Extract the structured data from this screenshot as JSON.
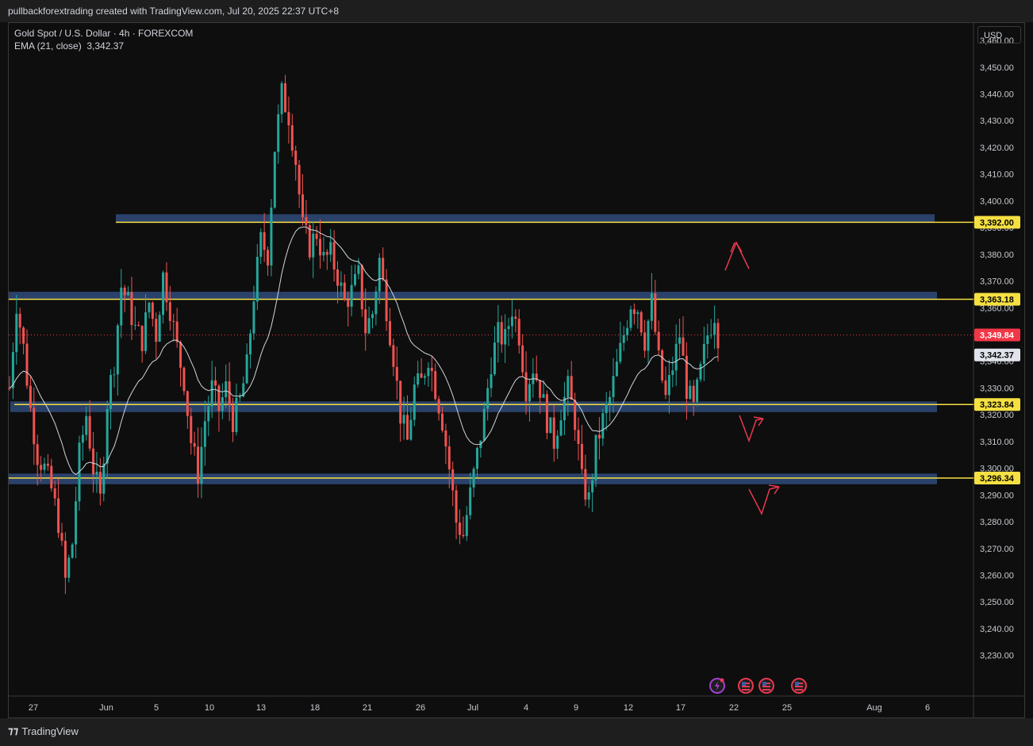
{
  "header": {
    "credit": "pullbackforextrading created with TradingView.com, Jul 20, 2025 22:37 UTC+8"
  },
  "legend": {
    "symbol": "Gold Spot / U.S. Dollar · 4h · FOREXCOM",
    "indicator": "EMA (21, close)",
    "indicator_value": "3,342.37"
  },
  "currency": "USD",
  "footer": {
    "brand": "TradingView"
  },
  "colors": {
    "up": "#26a69a",
    "down": "#ef5350",
    "zone": "#2f4a7a",
    "level_line": "#f5e042",
    "ema": "#d1d4dc",
    "arrow": "#e8384f",
    "current_price_tag": "#f23645"
  },
  "chart_data": {
    "type": "candlestick",
    "title": "Gold Spot / U.S. Dollar · 4h · FOREXCOM",
    "ylim": [
      3225,
      3470
    ],
    "y_ticks": [
      3230,
      3240,
      3250,
      3260,
      3270,
      3280,
      3290,
      3300,
      3310,
      3320,
      3330,
      3340,
      3350,
      3360,
      3370,
      3380,
      3390,
      3400,
      3410,
      3420,
      3430,
      3440,
      3450,
      3460
    ],
    "y_tick_labels": [
      "3,230.00",
      "3,240.00",
      "3,250.00",
      "3,260.00",
      "3,270.00",
      "3,280.00",
      "3,290.00",
      "3,300.00",
      "3,310.00",
      "3,320.00",
      "3,330.00",
      "3,340.00",
      "3,350.00",
      "3,360.00",
      "3,370.00",
      "3,380.00",
      "3,390.00",
      "3,400.00",
      "3,410.00",
      "3,420.00",
      "3,430.00",
      "3,440.00",
      "3,450.00",
      "3,460.00"
    ],
    "x_ticks": [
      "27",
      "Jun",
      "5",
      "10",
      "13",
      "18",
      "21",
      "26",
      "Jul",
      "4",
      "9",
      "12",
      "17",
      "22",
      "25",
      "Aug",
      "6"
    ],
    "grid": false,
    "price_levels": [
      {
        "label": "3,392.00",
        "value": 3392.0
      },
      {
        "label": "3,363.18",
        "value": 3363.18
      },
      {
        "label": "3,323.84",
        "value": 3323.84
      },
      {
        "label": "3,296.34",
        "value": 3296.34
      }
    ],
    "zones": [
      {
        "low": 3392,
        "high": 3395
      },
      {
        "low": 3363,
        "high": 3366
      },
      {
        "low": 3321,
        "high": 3325
      },
      {
        "low": 3294,
        "high": 3298
      }
    ],
    "current_price": {
      "label": "3,349.84",
      "value": 3349.84
    },
    "ema": {
      "name": "EMA (21, close)",
      "label": "3,342.37",
      "value": 3342.37
    },
    "price_path": [
      [
        0,
        3330
      ],
      [
        2,
        3362
      ],
      [
        4,
        3345
      ],
      [
        6,
        3322
      ],
      [
        8,
        3305
      ],
      [
        10,
        3300
      ],
      [
        12,
        3292
      ],
      [
        14,
        3280
      ],
      [
        16,
        3258
      ],
      [
        18,
        3272
      ],
      [
        20,
        3305
      ],
      [
        22,
        3320
      ],
      [
        24,
        3300
      ],
      [
        26,
        3288
      ],
      [
        28,
        3325
      ],
      [
        30,
        3340
      ],
      [
        32,
        3368
      ],
      [
        34,
        3362
      ],
      [
        36,
        3352
      ],
      [
        38,
        3348
      ],
      [
        40,
        3362
      ],
      [
        42,
        3350
      ],
      [
        44,
        3372
      ],
      [
        46,
        3360
      ],
      [
        48,
        3345
      ],
      [
        50,
        3333
      ],
      [
        52,
        3310
      ],
      [
        54,
        3298
      ],
      [
        56,
        3318
      ],
      [
        58,
        3330
      ],
      [
        60,
        3322
      ],
      [
        62,
        3330
      ],
      [
        64,
        3318
      ],
      [
        66,
        3325
      ],
      [
        68,
        3338
      ],
      [
        70,
        3365
      ],
      [
        72,
        3385
      ],
      [
        74,
        3380
      ],
      [
        76,
        3420
      ],
      [
        78,
        3440
      ],
      [
        80,
        3432
      ],
      [
        82,
        3415
      ],
      [
        84,
        3390
      ],
      [
        86,
        3383
      ],
      [
        88,
        3388
      ],
      [
        90,
        3378
      ],
      [
        92,
        3380
      ],
      [
        94,
        3372
      ],
      [
        96,
        3362
      ],
      [
        98,
        3366
      ],
      [
        100,
        3372
      ],
      [
        102,
        3352
      ],
      [
        104,
        3358
      ],
      [
        106,
        3378
      ],
      [
        108,
        3360
      ],
      [
        110,
        3342
      ],
      [
        112,
        3320
      ],
      [
        114,
        3310
      ],
      [
        116,
        3330
      ],
      [
        118,
        3332
      ],
      [
        120,
        3342
      ],
      [
        122,
        3330
      ],
      [
        124,
        3318
      ],
      [
        126,
        3300
      ],
      [
        128,
        3280
      ],
      [
        130,
        3275
      ],
      [
        132,
        3290
      ],
      [
        134,
        3305
      ],
      [
        136,
        3320
      ],
      [
        138,
        3340
      ],
      [
        140,
        3350
      ],
      [
        142,
        3348
      ],
      [
        144,
        3360
      ],
      [
        146,
        3350
      ],
      [
        148,
        3330
      ],
      [
        150,
        3338
      ],
      [
        152,
        3330
      ],
      [
        154,
        3318
      ],
      [
        156,
        3310
      ],
      [
        158,
        3322
      ],
      [
        160,
        3330
      ],
      [
        162,
        3318
      ],
      [
        164,
        3295
      ],
      [
        166,
        3288
      ],
      [
        168,
        3308
      ],
      [
        170,
        3318
      ],
      [
        172,
        3326
      ],
      [
        174,
        3338
      ],
      [
        176,
        3350
      ],
      [
        178,
        3362
      ],
      [
        180,
        3360
      ],
      [
        182,
        3348
      ],
      [
        184,
        3362
      ],
      [
        186,
        3340
      ],
      [
        188,
        3326
      ],
      [
        190,
        3338
      ],
      [
        192,
        3350
      ],
      [
        194,
        3330
      ],
      [
        196,
        3322
      ],
      [
        198,
        3336
      ],
      [
        200,
        3350
      ],
      [
        202,
        3358
      ],
      [
        203,
        3349.84
      ]
    ],
    "annotations": [
      "up-arrow-3392",
      "down-then-up-arrow-3323",
      "down-then-up-arrow-3296"
    ]
  }
}
